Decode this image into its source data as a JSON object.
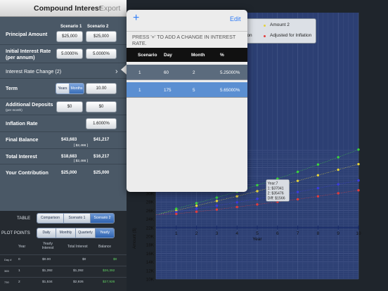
{
  "app": {
    "title": "Compound Interest",
    "export_label": "Export"
  },
  "inputs": {
    "scenario_headers": [
      "Scenario 1",
      "Scenario 2"
    ],
    "principal": {
      "label": "Principal Amount",
      "values": [
        "$25,000",
        "$25,000"
      ]
    },
    "initial_rate": {
      "label": "Initial Interest Rate",
      "sublabel": "(per annum)",
      "values": [
        "5.0000%",
        "5.0000%"
      ]
    },
    "rate_change": {
      "label": "Interest Rate Change (2)"
    },
    "term": {
      "label": "Term",
      "units": [
        "Years",
        "Months"
      ],
      "selected_unit": "Months",
      "value": "10.00"
    },
    "deposits": {
      "label": "Additional Deposits",
      "sublabel": "(per month)",
      "values": [
        "$0",
        "$0"
      ]
    },
    "inflation": {
      "label": "Inflation Rate",
      "value": "1.6000%"
    }
  },
  "results": {
    "final_balance": {
      "label": "Final Balance",
      "values": [
        "$43,683",
        "$41,217"
      ],
      "diff": "[ $2,466 ]"
    },
    "total_interest": {
      "label": "Total Interest",
      "values": [
        "$18,683",
        "$16,217"
      ],
      "diff": "[ $2,466 ]"
    },
    "contribution": {
      "label": "Your Contribution",
      "values": [
        "$25,000",
        "$25,000"
      ]
    }
  },
  "table": {
    "label": "TABLE",
    "options": [
      "Comparison",
      "Scenario 1",
      "Scenario 2"
    ],
    "selected": "Scenario 2",
    "plot_points_label": "PLOT POINTS",
    "plot_options": [
      "Daily",
      "Monthly",
      "Quarterly",
      "Yearly"
    ],
    "plot_selected": "Yearly",
    "headers": [
      "Year",
      "Yearly Interest",
      "Total Interest",
      "Balance"
    ],
    "rows": [
      {
        "marker": "Day #",
        "year": "0",
        "yearly": "$0.00",
        "total": "$0",
        "balance": "$0"
      },
      {
        "marker": "365",
        "year": "1",
        "yearly": "$1,392",
        "total": "$1,392",
        "balance": "$26,392"
      },
      {
        "marker": "730",
        "year": "2",
        "yearly": "$1,534",
        "total": "$2,926",
        "balance": "$27,926"
      }
    ]
  },
  "popover": {
    "add_label": "+",
    "edit_label": "Edit",
    "instructions": "PRESS '+' TO ADD A CHANGE IN INTEREST RATE.",
    "headers": [
      "Scenario",
      "Day",
      "Month",
      "%"
    ],
    "rows": [
      {
        "scenario": "1",
        "day": "60",
        "month": "2",
        "rate": "5.25000%"
      },
      {
        "scenario": "1",
        "day": "175",
        "month": "5",
        "rate": "5.65000%"
      }
    ]
  },
  "legend": {
    "items": [
      {
        "label": "Amount 2",
        "color": "#e4d23c"
      },
      {
        "label": "Adjusted for Inflation",
        "color": "#e23c3c"
      }
    ],
    "partial_label": "ion"
  },
  "colors": {
    "selected_row": "#5b8fd2",
    "row_dark": "#5b6b7d",
    "accent": "#2f7cf6"
  },
  "chart_data": {
    "type": "scatter",
    "xlabel": "Year",
    "ylabel": "Amount ($)",
    "x_ticks": [
      1,
      2,
      3,
      4,
      5,
      6,
      7,
      8,
      9,
      10
    ],
    "y_ticks": [
      "10K",
      "12K",
      "14K",
      "16K",
      "18K",
      "20K",
      "22K",
      "24K",
      "26K",
      "28K",
      "30K"
    ],
    "xlim": [
      0,
      10
    ],
    "ylim": [
      10000,
      30000
    ],
    "grid": true,
    "series": [
      {
        "name": "Amount 2",
        "color": "#e4d23c",
        "x": [
          1,
          2,
          3,
          4,
          5,
          6,
          7,
          8,
          9,
          10
        ],
        "y": [
          26000,
          27100,
          28200,
          29300,
          30500,
          31700,
          32900,
          34200,
          35500,
          36800
        ]
      },
      {
        "color": "#3cd23c",
        "x": [
          1,
          2,
          3,
          4,
          5,
          6,
          7,
          8,
          9,
          10
        ],
        "y": [
          26400,
          27700,
          29000,
          30400,
          31900,
          33400,
          35000,
          36700,
          38400,
          40200
        ]
      },
      {
        "color": "#3c3ce2",
        "x": [
          1,
          2,
          3,
          4,
          5,
          6,
          7,
          8,
          9,
          10
        ],
        "y": [
          25600,
          26400,
          27100,
          27900,
          28700,
          29500,
          30300,
          31200,
          32100,
          33000
        ]
      },
      {
        "name": "Adjusted for Inflation",
        "color": "#e23c3c",
        "x": [
          1,
          2,
          3,
          4,
          5,
          6,
          7,
          8,
          9,
          10
        ],
        "y": [
          25200,
          25700,
          26200,
          26800,
          27400,
          28000,
          28600,
          29300,
          30000,
          30700
        ]
      }
    ],
    "annotation": {
      "lines": [
        "Year:7",
        "1: $37041",
        "2: $35476",
        "Diff: $1566"
      ]
    }
  }
}
